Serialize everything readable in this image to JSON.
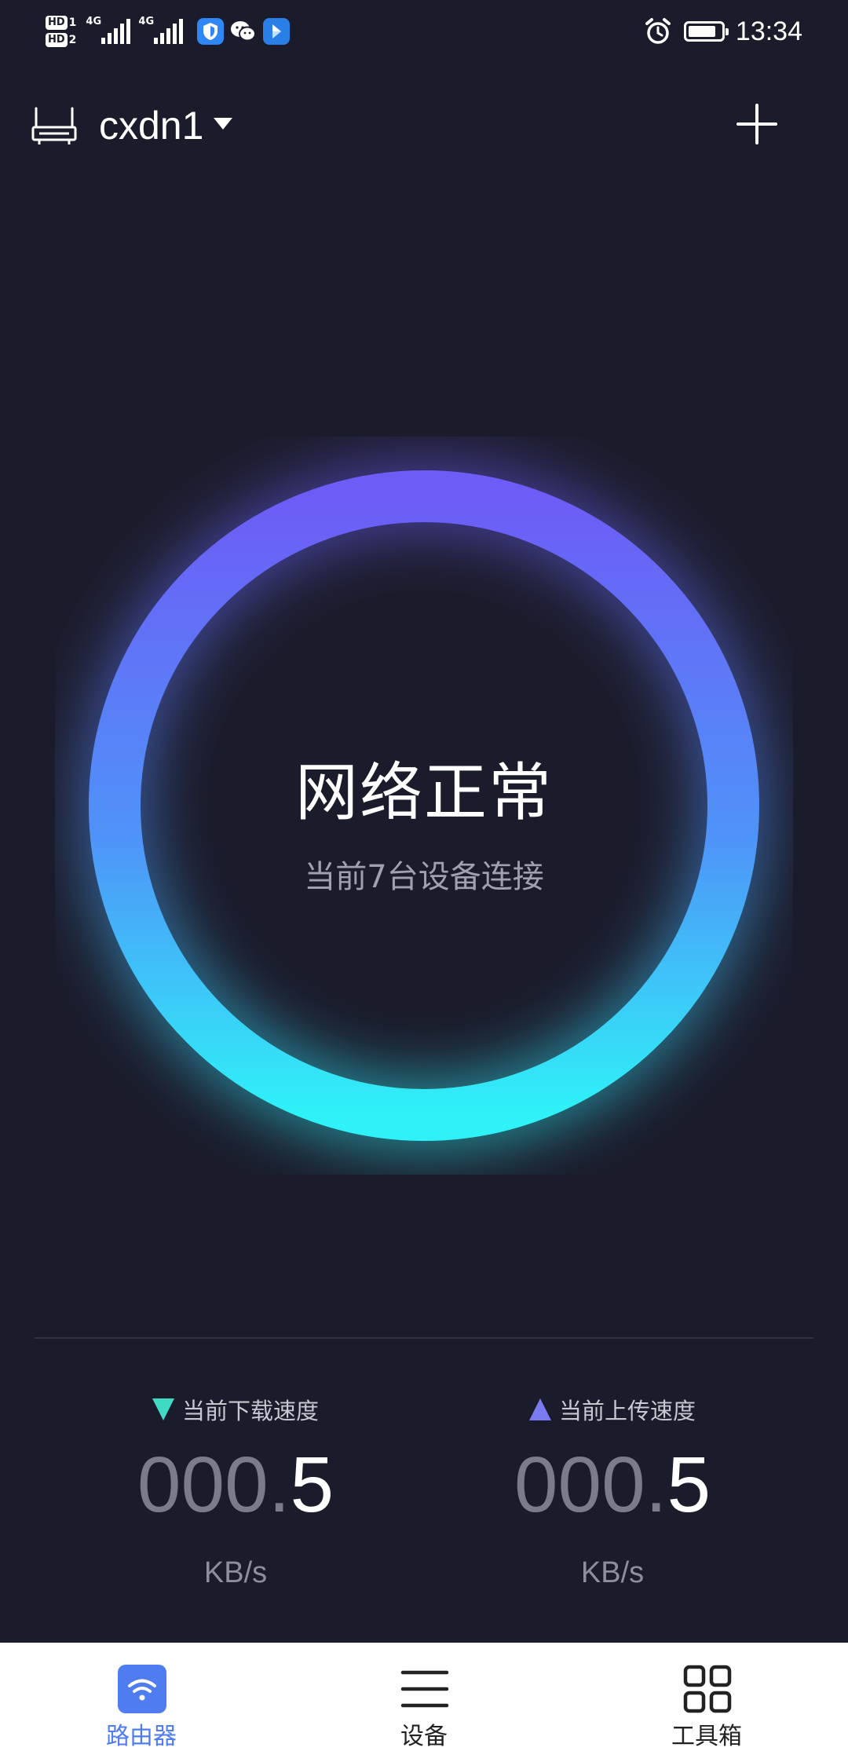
{
  "status_bar": {
    "sim1_badge": "HD",
    "sim1_num": "1",
    "sim2_badge": "HD",
    "sim2_num": "2",
    "network1": "4G",
    "network2": "4G",
    "time": "13:34",
    "battery_level": 0.85
  },
  "header": {
    "router_name": "cxdn1"
  },
  "status": {
    "title": "网络正常",
    "subtitle": "当前7台设备连接"
  },
  "speeds": {
    "download": {
      "label": "当前下载速度",
      "value_int": "000",
      "value_dot": ".",
      "value_frac": "5",
      "unit": "KB/s"
    },
    "upload": {
      "label": "当前上传速度",
      "value_int": "000",
      "value_dot": ".",
      "value_frac": "5",
      "unit": "KB/s"
    }
  },
  "nav": {
    "router": "路由器",
    "devices": "设备",
    "tools": "工具箱"
  },
  "colors": {
    "background": "#1b1c2b",
    "ring_top": "#6d5cf6",
    "ring_bottom": "#2ef2f7",
    "accent_active": "#4f7cf0",
    "download_marker": "#3fd9c4",
    "upload_marker": "#7a7bf0"
  },
  "icons": {
    "router": "router-icon",
    "dropdown": "caret-down-icon",
    "add": "plus-icon",
    "alarm": "alarm-icon",
    "nav_router": "wifi-icon",
    "nav_devices": "list-icon",
    "nav_tools": "grid-icon"
  }
}
